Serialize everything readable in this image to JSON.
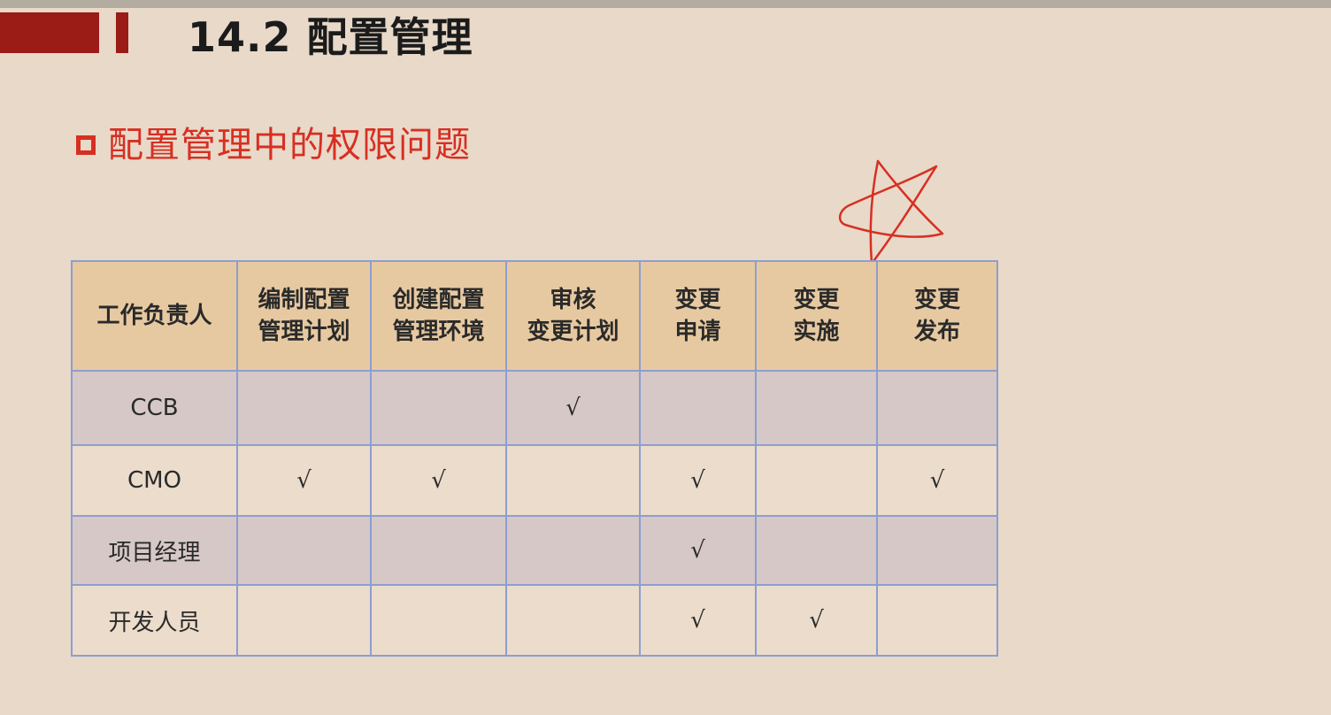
{
  "title": "14.2 配置管理",
  "section_heading": "配置管理中的权限问题",
  "table": {
    "headers": [
      [
        "工作负责人"
      ],
      [
        "编制配置",
        "管理计划"
      ],
      [
        "创建配置",
        "管理环境"
      ],
      [
        "审核",
        "变更计划"
      ],
      [
        "变更",
        "申请"
      ],
      [
        "变更",
        "实施"
      ],
      [
        "变更",
        "发布"
      ]
    ],
    "rows": [
      {
        "role": "CCB",
        "cells": [
          "",
          "",
          "√",
          "",
          "",
          ""
        ]
      },
      {
        "role": "CMO",
        "cells": [
          "√",
          "√",
          "",
          "√",
          "",
          "√"
        ]
      },
      {
        "role": "项目经理",
        "cells": [
          "",
          "",
          "",
          "√",
          "",
          ""
        ]
      },
      {
        "role": "开发人员",
        "cells": [
          "",
          "",
          "",
          "√",
          "√",
          ""
        ]
      }
    ]
  },
  "colors": {
    "accent_red": "#d72f22",
    "title_bar": "#9b1b17",
    "header_bg": "#e7c9a1",
    "border": "#8d9ed0"
  },
  "icons": [
    "bullet-square-icon",
    "star-annotation-icon"
  ]
}
